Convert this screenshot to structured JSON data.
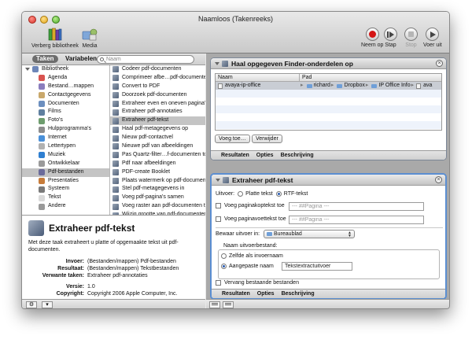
{
  "window": {
    "title": "Naamloos (Takenreeks)"
  },
  "toolbar": {
    "hide_library": "Verberg bibliotheek",
    "media": "Media",
    "record": "Neem op",
    "step": "Stap",
    "stop": "Stop",
    "run": "Voer uit"
  },
  "library": {
    "tabs": {
      "actions": "Taken",
      "variables": "Variabelen"
    },
    "search": {
      "placeholder": "Naam",
      "value": ""
    },
    "root": "Bibliotheek",
    "categories": [
      "Agenda",
      "Bestand…mappen",
      "Contactgegevens",
      "Documenten",
      "Films",
      "Foto's",
      "Hulpprogramma's",
      "Internet",
      "Lettertypen",
      "Muziek",
      "Ontwikkelaar",
      "Pdf-bestanden",
      "Presentaties",
      "Systeem",
      "Tekst",
      "Andere"
    ],
    "selected_category": "Pdf-bestanden",
    "actions": [
      "Codeer pdf-documenten",
      "Comprimeer afbe…pdf-documenten",
      "Convert to PDF",
      "Doorzoek pdf-documenten",
      "Extraheer even en oneven pagina's",
      "Extraheer pdf-annotaties",
      "Extraheer pdf-tekst",
      "Haal pdf-metagegevens op",
      "Nieuw pdf-contactvel",
      "Nieuwe pdf van afbeeldingen",
      "Pas Quartz-filter…f-documenten toe",
      "Pdf naar afbeeldingen",
      "PDF-create Booklet",
      "Plaats watermerk op pdf-documenten",
      "Stel pdf-metagegevens in",
      "Voeg pdf-pagina's samen",
      "Voeg raster aan pdf-documenten toe",
      "Wijzig grootte van pdf-documenten"
    ],
    "selected_action": "Extraheer pdf-tekst"
  },
  "description": {
    "title": "Extraheer pdf-tekst",
    "text": "Met deze taak extraheert u platte of opgemaakte tekst uit pdf-documenten.",
    "input_key": "Invoer:",
    "input_value": "(Bestanden/mappen) Pdf-bestanden",
    "result_key": "Resultaat:",
    "result_value": "(Bestanden/mappen) Tekstbestanden",
    "related_key": "Verwante taken:",
    "related_value": "Extraheer pdf-annotaties",
    "version_key": "Versie:",
    "version_value": "1.0",
    "copyright_key": "Copyright:",
    "copyright_value": "Copyright 2006 Apple Computer, Inc."
  },
  "workflow": {
    "action1": {
      "title": "Haal opgegeven Finder-onderdelen op",
      "col_name": "Naam",
      "col_path": "Pad",
      "rows": [
        {
          "name": "avaya-ip-office",
          "path": [
            "richard",
            "Dropbox",
            "IP Office Info",
            "ava"
          ]
        }
      ],
      "add_button": "Voeg toe…",
      "remove_button": "Verwijder",
      "footer": [
        "Resultaten",
        "Opties",
        "Beschrijving"
      ]
    },
    "action2": {
      "title": "Extraheer pdf-tekst",
      "output_label": "Uitvoer:",
      "plain_text": "Platte tekst",
      "rtf_text": "RTF-tekst",
      "output_selected": "RTF-tekst",
      "header_label": "Voeg paginakoptekst toe",
      "header_value": "--- ##Pagina ---",
      "footer_label": "Voeg paginavoettekst toe",
      "footer_value": "--- ##Pagina ---",
      "save_label": "Bewaar uitvoer in:",
      "save_value": "Bureaublad",
      "name_label": "Naam uitvoerbestand:",
      "same_as_input": "Zelfde als invoernaam",
      "custom_name": "Aangepaste naam",
      "custom_value": "Tekstextractuitvoer",
      "replace_label": "Vervang bestaande bestanden",
      "footer": [
        "Resultaten",
        "Opties",
        "Beschrijving"
      ]
    }
  },
  "colors": {
    "accent": "#5b8ed1",
    "record": "#d41515"
  },
  "icons": [
    "library-books-icon",
    "media-icon",
    "record-icon",
    "step-icon",
    "stop-icon",
    "run-icon",
    "gear-icon"
  ]
}
